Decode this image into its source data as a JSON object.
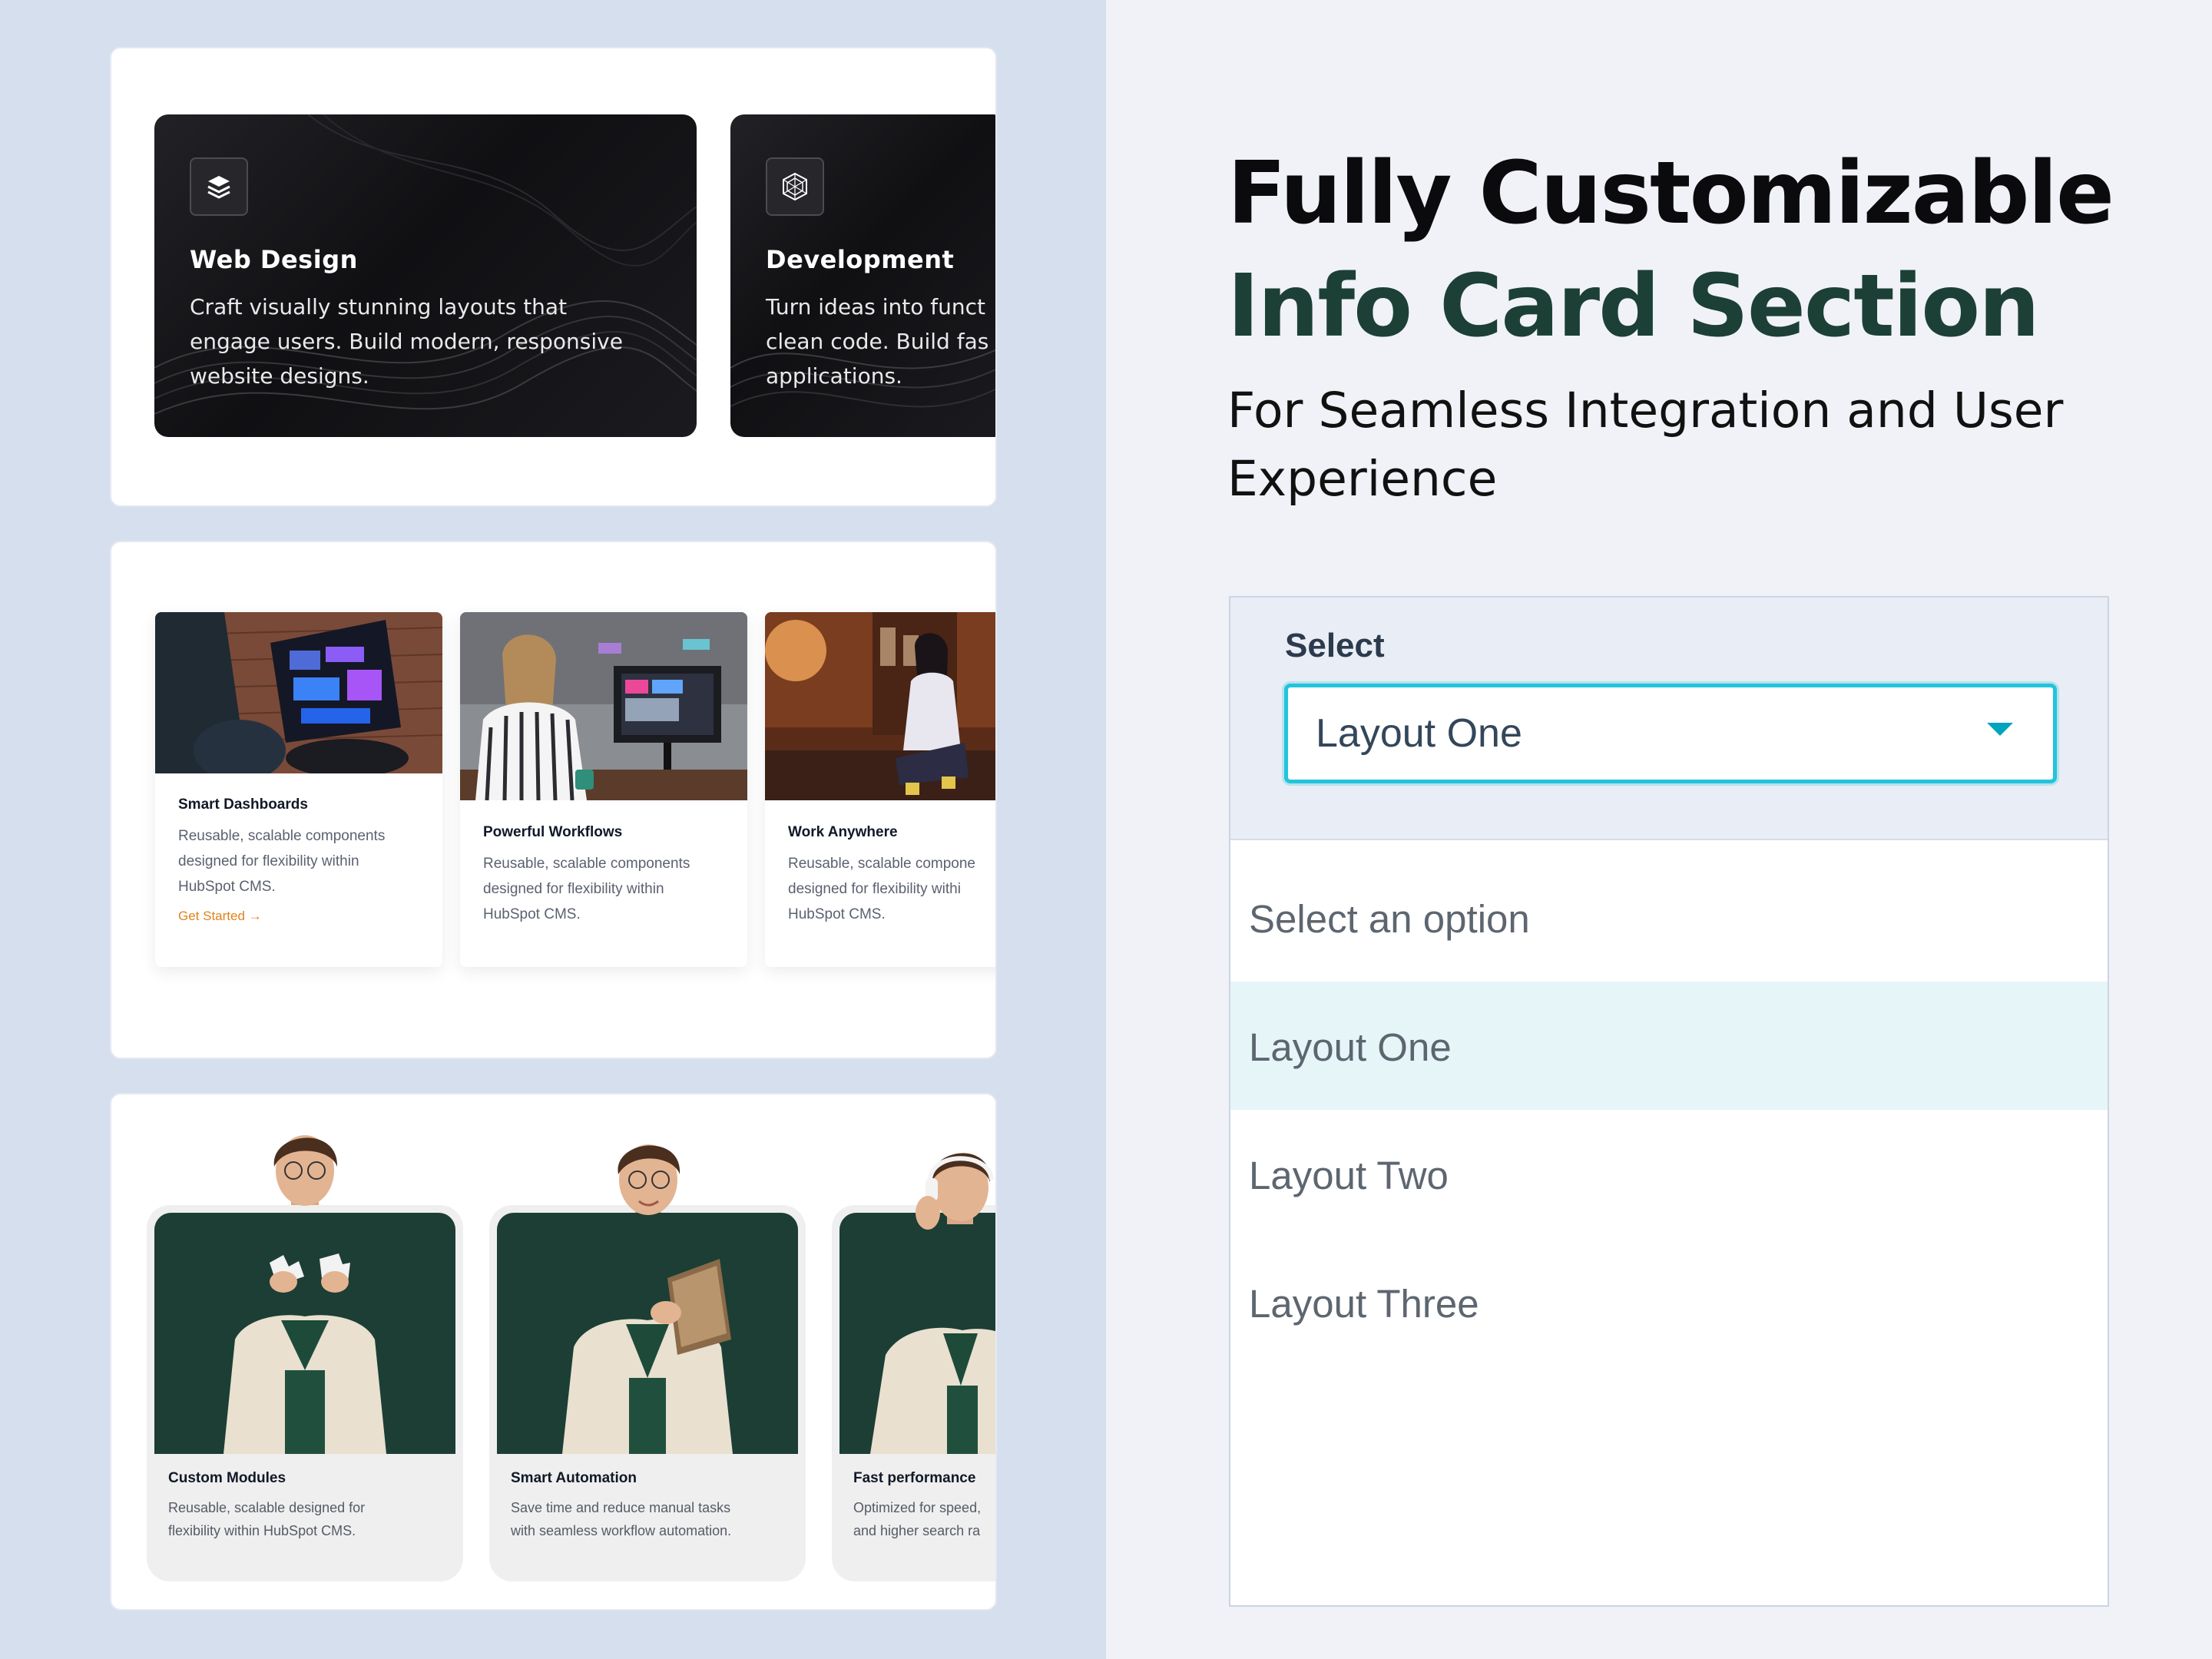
{
  "heading": {
    "line1": "Fully Customizable",
    "line2": "Info Card Section",
    "subtitle": "For Seamless Integration and User Experience"
  },
  "colors": {
    "brand_green": "#1c4036",
    "accent_cyan": "#22c4dc",
    "cta_orange": "#e0821c"
  },
  "dark_cards": [
    {
      "icon": "layers-icon",
      "title": "Web Design",
      "lines": [
        "Craft visually stunning layouts that",
        "engage users. Build modern, responsive",
        "website designs."
      ]
    },
    {
      "icon": "polygon-icon",
      "title": "Development",
      "lines": [
        "Turn ideas into funct",
        "clean code. Build fas",
        "applications."
      ]
    }
  ],
  "image_cards": [
    {
      "title": "Smart Dashboards",
      "lines": [
        "Reusable, scalable components",
        "designed for flexibility within",
        "HubSpot CMS."
      ],
      "cta": "Get Started →"
    },
    {
      "title": "Powerful Workflows",
      "lines": [
        "Reusable, scalable components",
        "designed for flexibility within",
        "HubSpot CMS."
      ]
    },
    {
      "title": "Work Anywhere",
      "lines": [
        "Reusable, scalable compone",
        "designed for flexibility withi",
        "HubSpot CMS."
      ]
    }
  ],
  "person_cards": [
    {
      "title": "Custom Modules",
      "lines": [
        "Reusable, scalable designed for",
        "flexibility within HubSpot CMS."
      ]
    },
    {
      "title": "Smart Automation",
      "lines": [
        "Save time and reduce manual tasks",
        "with seamless workflow automation."
      ]
    },
    {
      "title": "Fast performance",
      "lines": [
        "Optimized for speed,",
        "and higher search ra"
      ]
    }
  ],
  "select": {
    "label": "Select",
    "value": "Layout One",
    "options": [
      "Select an option",
      "Layout One",
      "Layout Two",
      "Layout Three"
    ],
    "selected_index": 1
  }
}
